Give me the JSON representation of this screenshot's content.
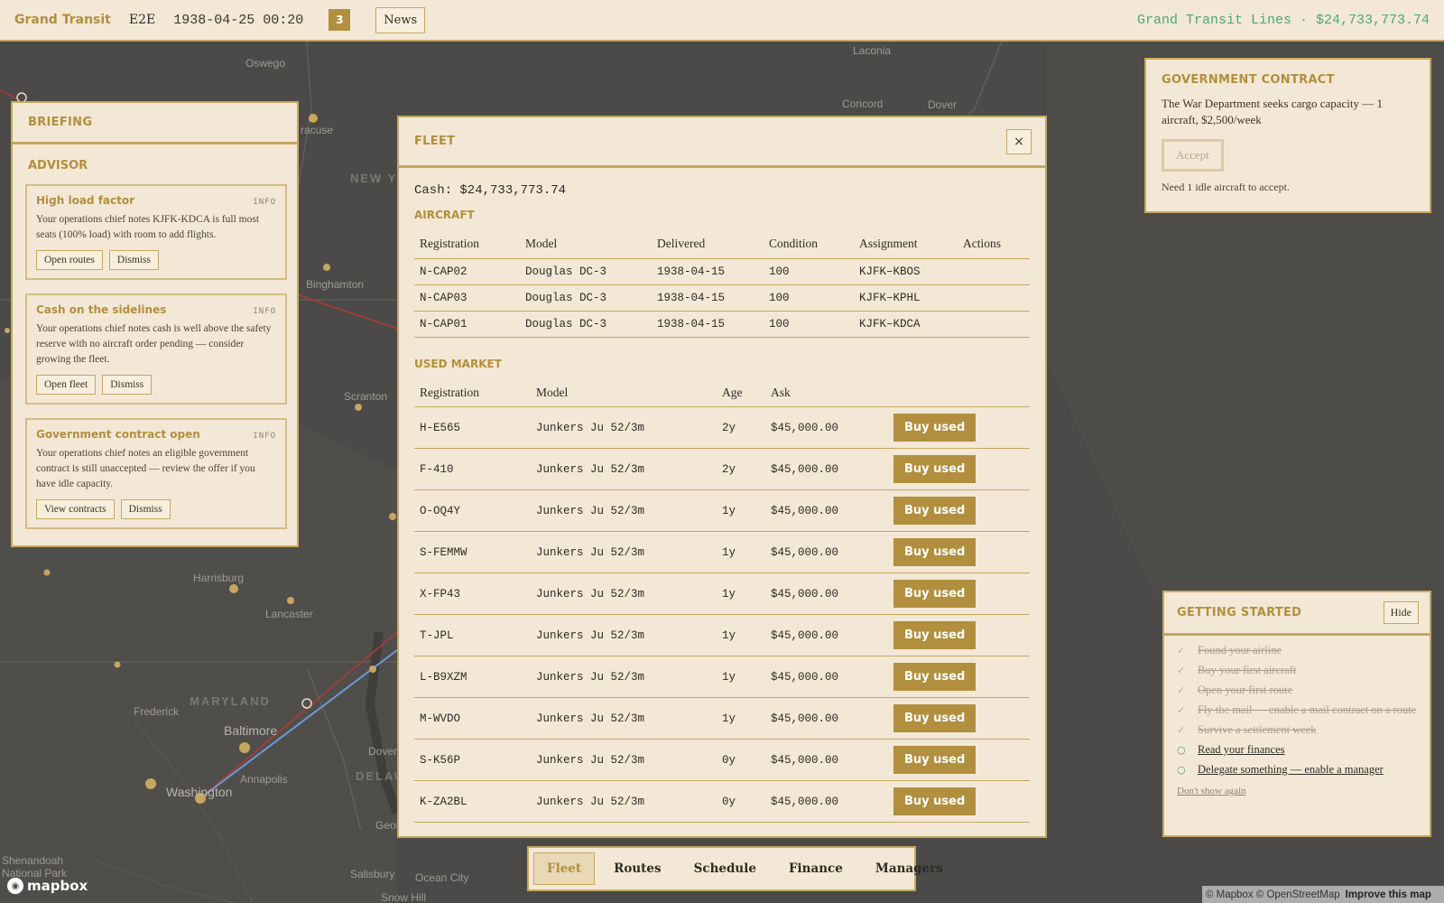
{
  "topbar": {
    "brand": "Grand Transit",
    "code": "E2E",
    "date": "1938-04-25 00:20",
    "badge_count": "3",
    "news_label": "News",
    "right_text": "Grand Transit Lines · $24,733,773.74"
  },
  "map": {
    "labels": {
      "oswego": "Oswego",
      "syracuse": "racuse",
      "new_york": "NEW Y",
      "binghamton": "Binghamton",
      "scranton": "Scranton",
      "harrisburg": "Harrisburg",
      "lancaster": "Lancaster",
      "maryland": "MARYLAND",
      "frederick": "Frederick",
      "baltimore": "Baltimore",
      "washington": "Washington",
      "annapolis": "Annapolis",
      "dover_md": "Dover",
      "delaware": "DELAWA",
      "shenandoah": "Shenandoah",
      "national_park": "National Park",
      "salisbury": "Salisbury",
      "ocean_city": "Ocean City",
      "laconia": "Laconia",
      "concord": "Concord",
      "dover": "Dover",
      "georg": "Georg",
      "snow_hill": "Snow Hill"
    },
    "colors": {
      "background": "#4b4a48",
      "route_red": "#b03a36",
      "route_blue": "#6b9bd8",
      "city": "#c6a75f"
    }
  },
  "briefing": {
    "title": "BRIEFING",
    "advisor_title": "ADVISOR",
    "cards": [
      {
        "title": "High load factor",
        "tag": "INFO",
        "body": "Your operations chief notes KJFK-KDCA is full most seats (100% load) with room to add flights.",
        "actions": [
          "Open routes",
          "Dismiss"
        ]
      },
      {
        "title": "Cash on the sidelines",
        "tag": "INFO",
        "body": "Your operations chief notes cash is well above the safety reserve with no aircraft order pending — consider growing the fleet.",
        "actions": [
          "Open fleet",
          "Dismiss"
        ]
      },
      {
        "title": "Government contract open",
        "tag": "INFO",
        "body": "Your operations chief notes an eligible government contract is still unaccepted — review the offer if you have idle capacity.",
        "actions": [
          "View contracts",
          "Dismiss"
        ]
      }
    ]
  },
  "fleet": {
    "title": "FLEET",
    "close_label": "×",
    "cash": "Cash: $24,733,773.74",
    "aircraft_title": "AIRCRAFT",
    "aircraft_headers": [
      "Registration",
      "Model",
      "Delivered",
      "Condition",
      "Assignment",
      "Actions"
    ],
    "aircraft": [
      [
        "N-CAP02",
        "Douglas DC-3",
        "1938-04-15",
        "100",
        "KJFK–KBOS",
        ""
      ],
      [
        "N-CAP03",
        "Douglas DC-3",
        "1938-04-15",
        "100",
        "KJFK–KPHL",
        ""
      ],
      [
        "N-CAP01",
        "Douglas DC-3",
        "1938-04-15",
        "100",
        "KJFK–KDCA",
        ""
      ]
    ],
    "market_title": "USED MARKET",
    "market_headers": [
      "Registration",
      "Model",
      "Age",
      "Ask",
      ""
    ],
    "buy_label": "Buy used",
    "market": [
      [
        "H-E565",
        "Junkers Ju 52/3m",
        "2y",
        "$45,000.00"
      ],
      [
        "F-410",
        "Junkers Ju 52/3m",
        "2y",
        "$45,000.00"
      ],
      [
        "O-OQ4Y",
        "Junkers Ju 52/3m",
        "1y",
        "$45,000.00"
      ],
      [
        "S-FEMMW",
        "Junkers Ju 52/3m",
        "1y",
        "$45,000.00"
      ],
      [
        "X-FP43",
        "Junkers Ju 52/3m",
        "1y",
        "$45,000.00"
      ],
      [
        "T-JPL",
        "Junkers Ju 52/3m",
        "1y",
        "$45,000.00"
      ],
      [
        "L-B9XZM",
        "Junkers Ju 52/3m",
        "1y",
        "$45,000.00"
      ],
      [
        "M-WVDO",
        "Junkers Ju 52/3m",
        "1y",
        "$45,000.00"
      ],
      [
        "S-K56P",
        "Junkers Ju 52/3m",
        "0y",
        "$45,000.00"
      ],
      [
        "K-ZA2BL",
        "Junkers Ju 52/3m",
        "0y",
        "$45,000.00"
      ]
    ]
  },
  "gov": {
    "title": "GOVERNMENT CONTRACT",
    "text": "The War Department seeks cargo capacity — 1 aircraft, $2,500/week",
    "accept_label": "Accept",
    "note": "Need 1 idle aircraft to accept."
  },
  "getting_started": {
    "title": "GETTING STARTED",
    "hide_label": "Hide",
    "items": [
      {
        "text": "Found your airline",
        "done": true
      },
      {
        "text": "Buy your first aircraft",
        "done": true
      },
      {
        "text": "Open your first route",
        "done": true
      },
      {
        "text": "Fly the mail — enable a mail contract on a route",
        "done": true
      },
      {
        "text": "Survive a settlement week",
        "done": true
      },
      {
        "text": "Read your finances",
        "done": false
      },
      {
        "text": "Delegate something — enable a manager",
        "done": false
      }
    ],
    "done_mark": "✓",
    "todo_mark": "○",
    "dont_show": "Don't show again"
  },
  "bottomnav": {
    "tabs": [
      "Fleet",
      "Routes",
      "Schedule",
      "Finance",
      "Managers"
    ],
    "active": "Fleet"
  },
  "attribution": {
    "logo": "mapbox",
    "copyright": "© Mapbox © OpenStreetMap",
    "improve": "Improve this map"
  }
}
